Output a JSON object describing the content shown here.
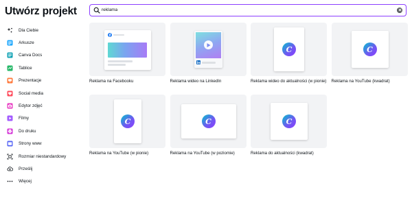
{
  "page_title": "Utwórz projekt",
  "search": {
    "value": "reklama",
    "icon": "search-icon",
    "clear_icon": "clear-icon",
    "border_color": "#8b3dff"
  },
  "sidebar": {
    "items": [
      {
        "label": "Dla Ciebie",
        "icon": "sparkle-icon",
        "color": "#0e1318"
      },
      {
        "label": "Arkusze",
        "icon": "sheet-icon",
        "color": "#1ea7fd"
      },
      {
        "label": "Canva Docs",
        "icon": "doc-icon",
        "color": "#13a3b5"
      },
      {
        "label": "Tablice",
        "icon": "whiteboard-icon",
        "color": "#25b767"
      },
      {
        "label": "Prezentacje",
        "icon": "presentation-icon",
        "color": "#ff7a3d"
      },
      {
        "label": "Social media",
        "icon": "heart-icon",
        "color": "#ff4d5e"
      },
      {
        "label": "Edytor zdjęć",
        "icon": "camera-icon",
        "color": "#e838c2"
      },
      {
        "label": "Filmy",
        "icon": "video-icon",
        "color": "#a35cff"
      },
      {
        "label": "Do druku",
        "icon": "printer-icon",
        "color": "#d32fd6"
      },
      {
        "label": "Strony www",
        "icon": "website-icon",
        "color": "#5161f5"
      },
      {
        "label": "Rozmiar niestandardowy",
        "icon": "custom-size-icon",
        "color": "#0e1318"
      },
      {
        "label": "Prześlij",
        "icon": "upload-icon",
        "color": "#0e1318"
      },
      {
        "label": "Więcej",
        "icon": "more-icon",
        "color": "#0e1318"
      }
    ]
  },
  "results": [
    {
      "label": "Reklama na Facebooku",
      "thumb": "facebook-ad"
    },
    {
      "label": "Reklama wideo na LinkedIn",
      "thumb": "linkedin-video"
    },
    {
      "label": "Reklama wideo do aktualności (w pionie)",
      "thumb": "portrait"
    },
    {
      "label": "Reklama na YouTube (kwadrat)",
      "thumb": "square"
    },
    {
      "label": "Reklama na YouTube (w pionie)",
      "thumb": "tall"
    },
    {
      "label": "Reklama na YouTube (w poziomie)",
      "thumb": "landscape"
    },
    {
      "label": "Reklama do aktualności (kwadrat)",
      "thumb": "square"
    }
  ],
  "colors": {
    "accent": "#8b3dff",
    "thumb_bg": "#f2f3f5"
  }
}
